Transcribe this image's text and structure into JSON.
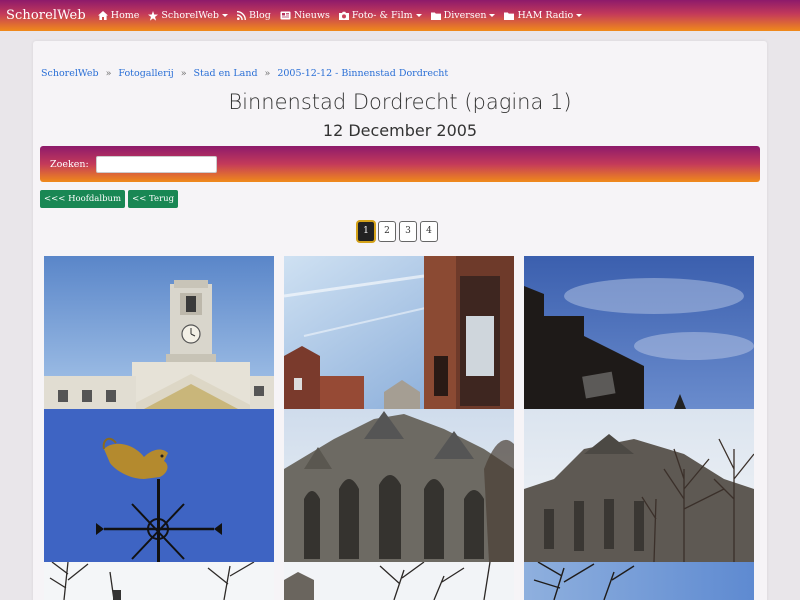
{
  "navbar": {
    "brand": "SchorelWeb",
    "items": [
      {
        "label": "Home",
        "icon": "home-icon"
      },
      {
        "label": "SchorelWeb",
        "icon": "star-icon",
        "dropdown": true
      },
      {
        "label": "Blog",
        "icon": "rss-icon"
      },
      {
        "label": "Nieuws",
        "icon": "newspaper-icon"
      },
      {
        "label": "Foto- & Film",
        "icon": "camera-icon",
        "dropdown": true
      },
      {
        "label": "Diversen",
        "icon": "folder-icon",
        "dropdown": true
      },
      {
        "label": "HAM Radio",
        "icon": "folder-icon",
        "dropdown": true
      }
    ]
  },
  "breadcrumb": [
    "SchorelWeb",
    "Fotogallerij",
    "Stad en Land",
    "2005-12-12 - Binnenstad Dordrecht"
  ],
  "page": {
    "title": "Binnenstad Dordrecht (pagina 1)",
    "subtitle": "12 December 2005"
  },
  "search": {
    "label": "Zoeken:",
    "value": ""
  },
  "buttons": {
    "main_album": "<<< Hoofdalbum",
    "back": "<< Terug"
  },
  "pagination": {
    "pages": [
      "1",
      "2",
      "3",
      "4"
    ],
    "current": "1"
  },
  "gallery": [
    "town-hall-clock-tower",
    "brick-houses-sky",
    "dark-building-blue-sky",
    "golden-rooster-weathervane",
    "gothic-church-facade",
    "church-bare-trees",
    "bare-tree-lamp",
    "church-branches",
    "tree-blue-sky"
  ],
  "colors": {
    "nav_gradient": [
      "#8d1a6b",
      "#f08a1a"
    ],
    "button_green": "#198754",
    "link_blue": "#2a6fd6"
  }
}
